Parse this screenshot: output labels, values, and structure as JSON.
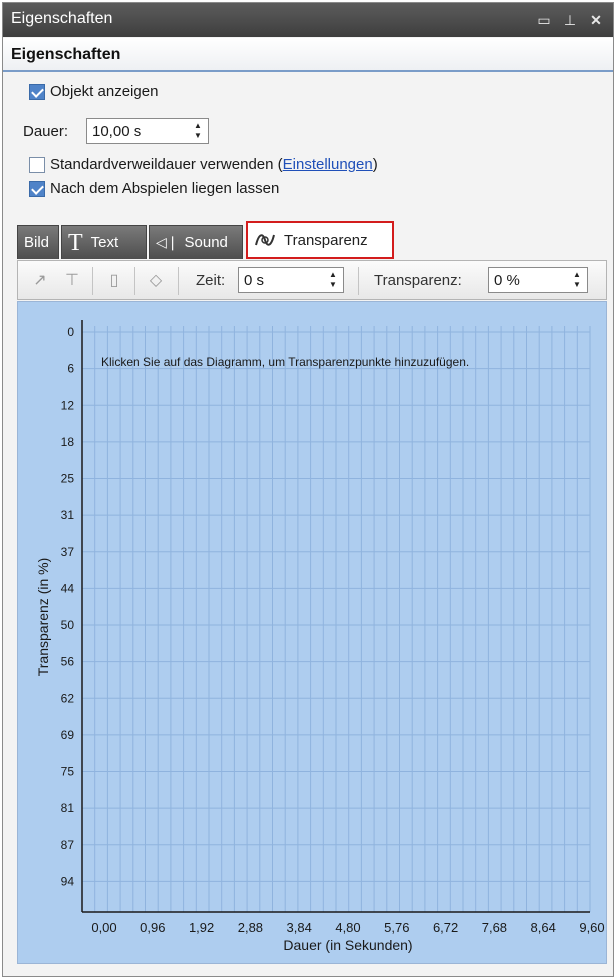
{
  "window": {
    "title": "Eigenschaften"
  },
  "section": {
    "title": "Eigenschaften"
  },
  "options": {
    "objekt_anzeigen": "Objekt anzeigen",
    "dauer_label": "Dauer:",
    "dauer_value": "10,00 s",
    "standard_text": "Standardverweildauer verwenden (",
    "einstellungen_link": "Einstellungen",
    "standard_close": ")",
    "liegen_lassen": "Nach dem Abspielen liegen lassen"
  },
  "tabs": [
    {
      "label": "Bild"
    },
    {
      "label": "Text"
    },
    {
      "label": "Sound"
    },
    {
      "label": "Transparenz"
    }
  ],
  "toolbar": {
    "zeit_label": "Zeit:",
    "zeit_value": "0 s",
    "transparenz_label": "Transparenz:",
    "transparenz_value": "0 %"
  },
  "chart_data": {
    "type": "line",
    "hint": "Klicken Sie auf das Diagramm, um Transparenzpunkte hinzuzufügen.",
    "xlabel": "Dauer (in Sekunden)",
    "ylabel": "Transparenz (in %)",
    "x_ticks": [
      "0,00",
      "0,96",
      "1,92",
      "2,88",
      "3,84",
      "4,80",
      "5,76",
      "6,72",
      "7,68",
      "8,64",
      "9,60"
    ],
    "y_ticks": [
      "0",
      "6",
      "12",
      "18",
      "25",
      "31",
      "37",
      "44",
      "50",
      "56",
      "62",
      "69",
      "75",
      "81",
      "87",
      "94"
    ],
    "series": [],
    "grid": true
  }
}
